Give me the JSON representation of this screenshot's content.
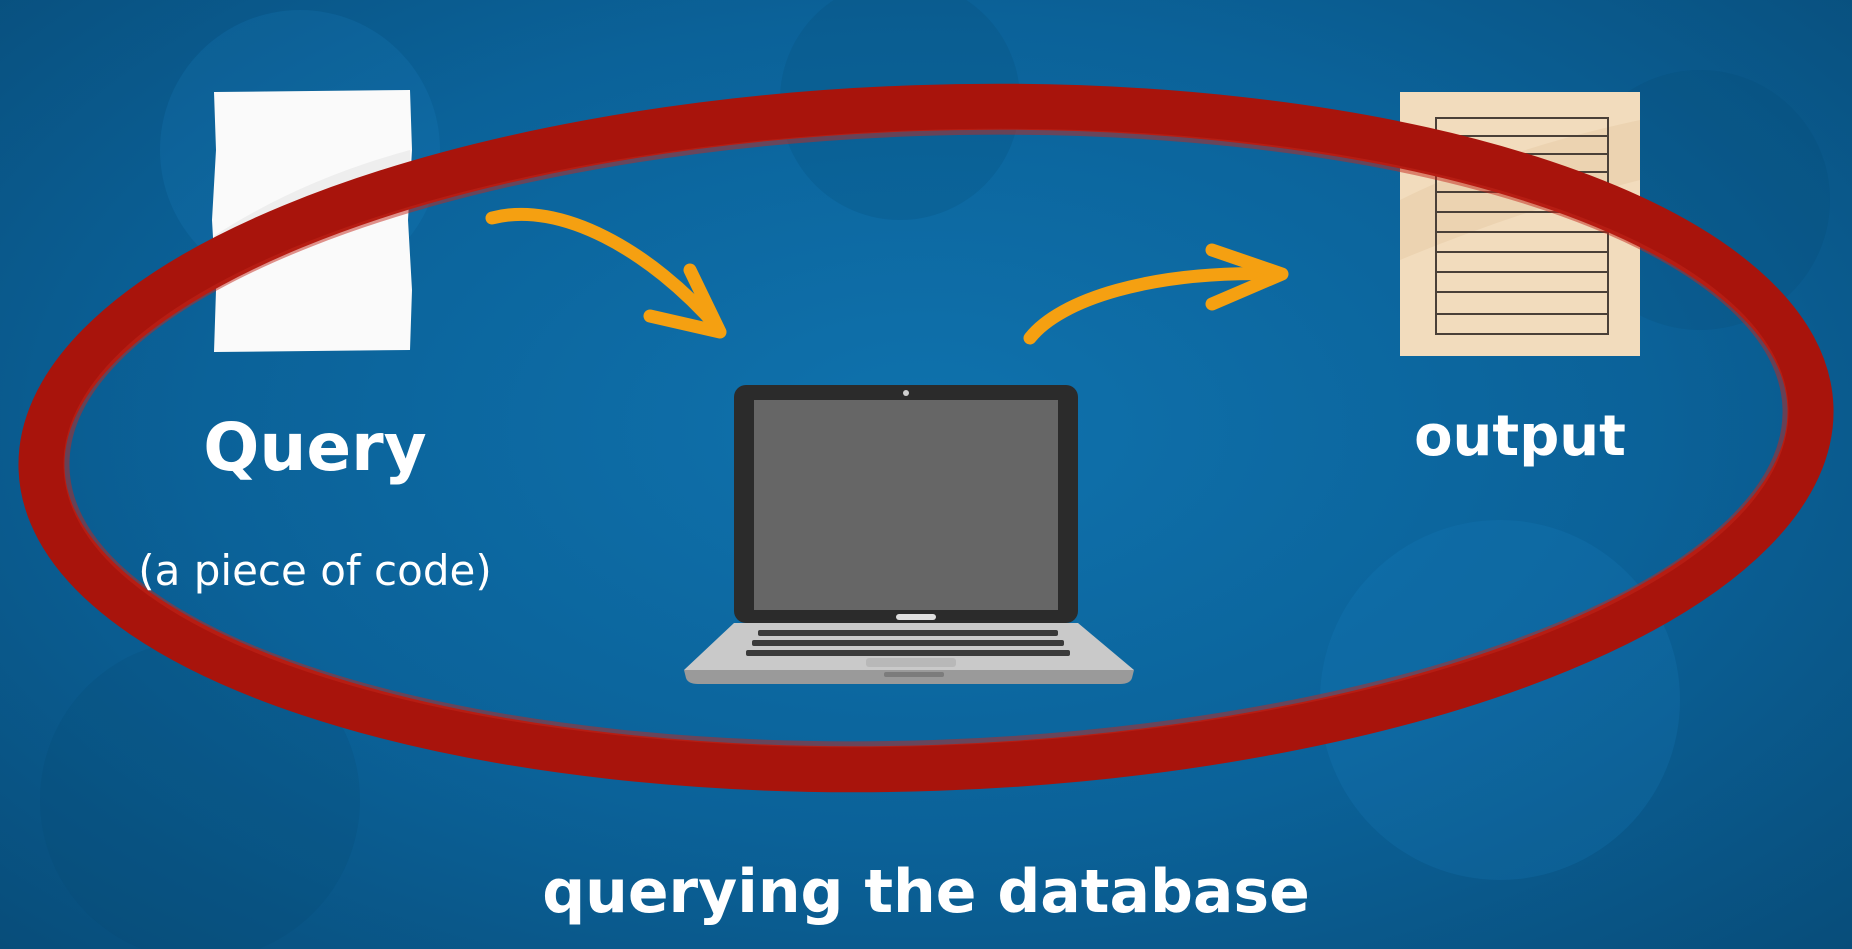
{
  "query": {
    "title": "Query",
    "subtitle": "(a piece of code)"
  },
  "output": {
    "title": "output"
  },
  "caption": "querying the database",
  "colors": {
    "background": "#0b6299",
    "highlight_ring": "#a8140c",
    "arrow": "#f5a011",
    "query_paper": "#fafafa",
    "output_paper": "#f2dcbd",
    "text": "#ffffff"
  },
  "icons": {
    "query": "document-icon",
    "computer": "laptop-icon",
    "output": "report-icon",
    "flow": "arrow-icon"
  }
}
